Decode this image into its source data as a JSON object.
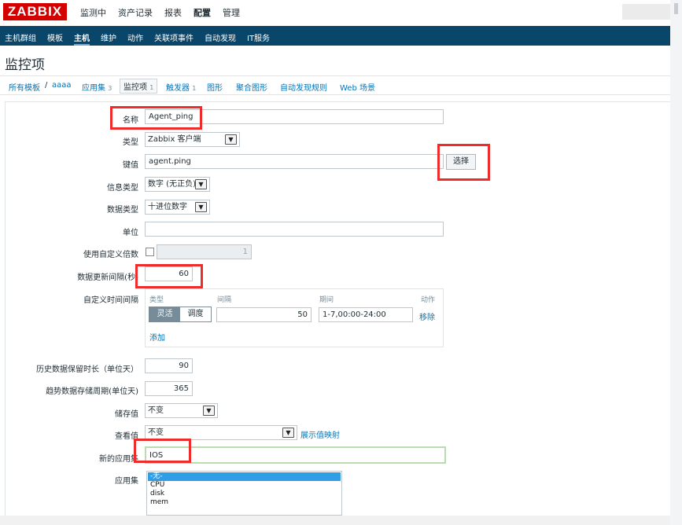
{
  "logo": "ZABBIX",
  "main_menu": [
    {
      "label": "监测中",
      "active": false
    },
    {
      "label": "资产记录",
      "active": false
    },
    {
      "label": "报表",
      "active": false
    },
    {
      "label": "配置",
      "active": true
    },
    {
      "label": "管理",
      "active": false
    }
  ],
  "sub_menu": [
    {
      "label": "主机群组",
      "active": false
    },
    {
      "label": "模板",
      "active": false
    },
    {
      "label": "主机",
      "active": true
    },
    {
      "label": "维护",
      "active": false
    },
    {
      "label": "动作",
      "active": false
    },
    {
      "label": "关联项事件",
      "active": false
    },
    {
      "label": "自动发现",
      "active": false
    },
    {
      "label": "IT服务",
      "active": false
    }
  ],
  "page_title": "监控项",
  "breadcrumb": {
    "all_templates": "所有模板",
    "separator": "/",
    "template": "aaaa",
    "applications": {
      "label": "应用集",
      "count": "3"
    },
    "items": {
      "label": "监控项",
      "count": "1"
    },
    "triggers": {
      "label": "触发器",
      "count": "1"
    },
    "graphs": "图形",
    "screens": "聚合图形",
    "discovery": "自动发现规则",
    "web": "Web 场景"
  },
  "form": {
    "name": {
      "label": "名称",
      "value": "Agent_ping"
    },
    "type": {
      "label": "类型",
      "value": "Zabbix 客户端"
    },
    "key": {
      "label": "键值",
      "value": "agent.ping",
      "select_button": "选择"
    },
    "info_type": {
      "label": "信息类型",
      "value": "数字 (无正负)"
    },
    "data_type": {
      "label": "数据类型",
      "value": "十进位数字"
    },
    "units": {
      "label": "单位",
      "value": ""
    },
    "multiplier": {
      "label": "使用自定义倍数",
      "checked": false,
      "value": "1"
    },
    "update_interval": {
      "label": "数据更新间隔(秒)",
      "value": "60"
    },
    "custom_intervals": {
      "label": "自定义时间间隔",
      "columns": {
        "type": "类型",
        "interval": "间隔",
        "period": "期间",
        "action": "动作"
      },
      "row": {
        "flexible": "灵活",
        "scheduling": "调度",
        "interval": "50",
        "period": "1-7,00:00-24:00",
        "remove": "移除"
      },
      "add": "添加"
    },
    "history": {
      "label": "历史数据保留时长（单位天）",
      "value": "90"
    },
    "trends": {
      "label": "趋势数据存储周期(单位天)",
      "value": "365"
    },
    "store_value": {
      "label": "储存值",
      "value": "不变"
    },
    "show_value": {
      "label": "查看值",
      "value": "不变",
      "link": "展示值映射"
    },
    "new_application": {
      "label": "新的应用集",
      "value": "IOS"
    },
    "applications": {
      "label": "应用集",
      "options": [
        "-无-",
        "CPU",
        "disk",
        "mem"
      ],
      "selected": "-无-"
    }
  },
  "colors": {
    "highlight": "#ee2c2c",
    "header": "#0a466a",
    "link": "#0275b8",
    "logo": "#d40000"
  }
}
